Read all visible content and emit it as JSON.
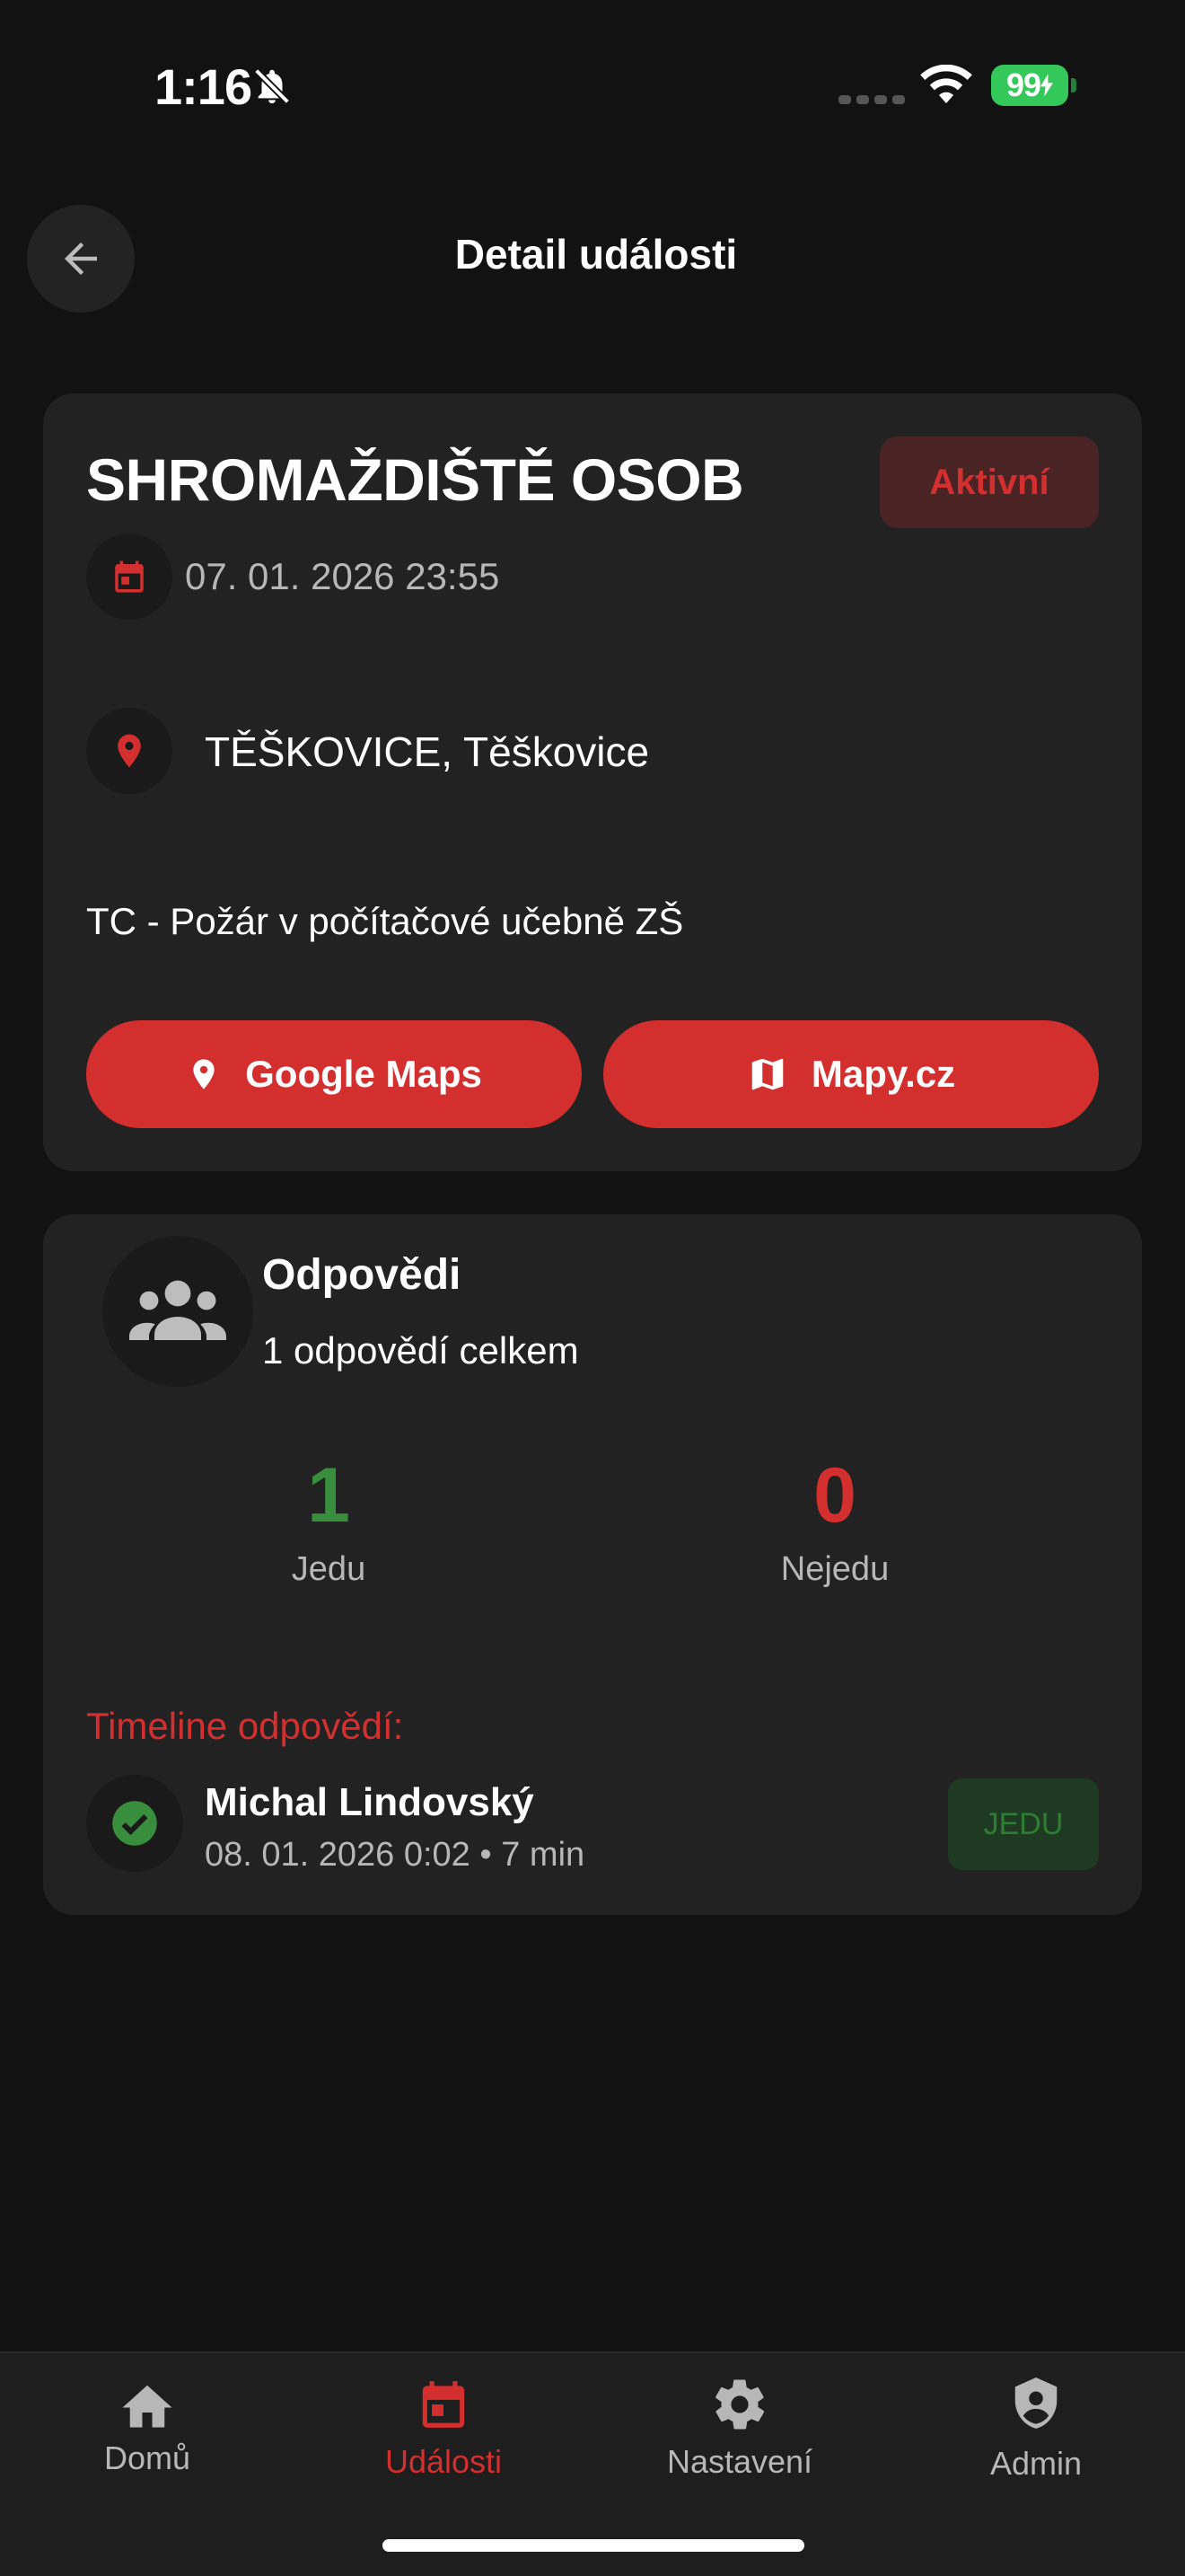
{
  "status_bar": {
    "time": "1:16",
    "battery": "99"
  },
  "header": {
    "title": "Detail události",
    "back_icon": "arrow-left-icon"
  },
  "event": {
    "title": "SHROMAŽDIŠTĚ OSOB",
    "status": "Aktivní",
    "datetime": "07. 01. 2026 23:55",
    "location": "TĚŠKOVICE, Těškovice",
    "description": "TC - Požár v počítačové učebně ZŠ",
    "buttons": {
      "google_maps": "Google Maps",
      "mapy_cz": "Mapy.cz"
    }
  },
  "responses": {
    "title": "Odpovědi",
    "subtitle": "1 odpovědí celkem",
    "stats": {
      "yes_count": "1",
      "yes_label": "Jedu",
      "no_count": "0",
      "no_label": "Nejedu"
    },
    "timeline_title": "Timeline odpovědí:",
    "timeline": [
      {
        "name": "Michal Lindovský",
        "meta": "08. 01. 2026 0:02 • 7 min",
        "badge": "JEDU"
      }
    ]
  },
  "nav": {
    "items": [
      {
        "label": "Domů",
        "icon": "home-icon"
      },
      {
        "label": "Události",
        "icon": "calendar-icon",
        "active": true
      },
      {
        "label": "Nastavení",
        "icon": "gear-icon"
      },
      {
        "label": "Admin",
        "icon": "admin-shield-icon"
      }
    ]
  },
  "colors": {
    "background": "#121212",
    "card": "#222222",
    "accent_red": "#d32f2f",
    "accent_green": "#388e3c"
  }
}
